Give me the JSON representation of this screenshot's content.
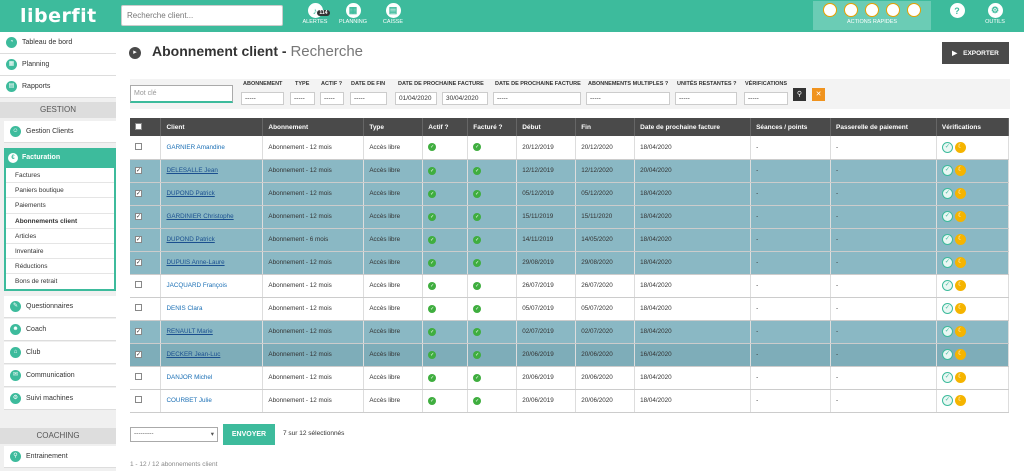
{
  "app": {
    "logo": "liberfit"
  },
  "search": {
    "placeholder": "Recherche client..."
  },
  "topnav": {
    "alertes": {
      "label": "ALERTES",
      "badge": "114"
    },
    "planning": {
      "label": "PLANNING"
    },
    "caisse": {
      "label": "CAISSE"
    },
    "actions_rapides": {
      "label": "ACTIONS RAPIDES"
    },
    "aide": {
      "label": "?"
    },
    "outils": {
      "label": "OUTILS"
    }
  },
  "sidebar": {
    "top_items": [
      {
        "label": "Tableau de bord",
        "icon": "dashboard-icon"
      },
      {
        "label": "Planning",
        "icon": "calendar-icon"
      },
      {
        "label": "Rapports",
        "icon": "report-icon"
      }
    ],
    "section_gestion": "GESTION",
    "gestion_clients": "Gestion Clients",
    "facturation": "Facturation",
    "facturation_sub": [
      "Factures",
      "Paniers boutique",
      "Paiements",
      "Abonnements client",
      "Articles",
      "Inventaire",
      "Réductions",
      "Bons de retrait"
    ],
    "after_items": [
      "Questionnaires",
      "Coach",
      "Club",
      "Communication",
      "Suivi machines"
    ],
    "section_coaching": "COACHING",
    "coaching_items": [
      "Entrainement"
    ]
  },
  "page": {
    "title": "Abonnement client",
    "subtitle": "Recherche",
    "export_label": "EXPORTER"
  },
  "filters": {
    "keyword_placeholder": "Mot clé",
    "cols": {
      "abonnement": "ABONNEMENT",
      "type": "TYPE",
      "actif": "ACTIF ?",
      "date_fin": "DATE DE FIN",
      "date_prochaine_1": "DATE DE PROCHAINE FACTURE",
      "date_prochaine_2": "DATE DE PROCHAINE FACTURE",
      "multiples": "ABONNEMENTS MULTIPLES ?",
      "unites": "UNITÉS RESTANTES ?",
      "verifications": "VÉRIFICATIONS"
    },
    "placeholder_dash": "-----",
    "date_from": "01/04/2020",
    "date_to": "30/04/2020"
  },
  "table": {
    "headers": [
      "Client",
      "Abonnement",
      "Type",
      "Actif ?",
      "Facturé ?",
      "Début",
      "Fin",
      "Date de prochaine facture",
      "Séances / points",
      "Passerelle de paiement",
      "Vérifications"
    ],
    "rows": [
      {
        "client": "GARNIER Amandine",
        "abonnement": "Abonnement - 12 mois",
        "type": "Accès libre",
        "debut": "20/12/2019",
        "fin": "20/12/2020",
        "prochaine": "18/04/2020",
        "seances": "-",
        "passerelle": "-",
        "selected": false
      },
      {
        "client": "DELESALLE Jean",
        "abonnement": "Abonnement - 12 mois",
        "type": "Accès libre",
        "debut": "12/12/2019",
        "fin": "12/12/2020",
        "prochaine": "20/04/2020",
        "seances": "-",
        "passerelle": "-",
        "selected": true
      },
      {
        "client": "DUPOND Patrick",
        "abonnement": "Abonnement - 12 mois",
        "type": "Accès libre",
        "debut": "05/12/2019",
        "fin": "05/12/2020",
        "prochaine": "18/04/2020",
        "seances": "-",
        "passerelle": "-",
        "selected": true
      },
      {
        "client": "GARDINIER Christophe",
        "abonnement": "Abonnement - 12 mois",
        "type": "Accès libre",
        "debut": "15/11/2019",
        "fin": "15/11/2020",
        "prochaine": "18/04/2020",
        "seances": "-",
        "passerelle": "-",
        "selected": true
      },
      {
        "client": "DUPOND Patrick",
        "abonnement": "Abonnement - 6 mois",
        "type": "Accès libre",
        "debut": "14/11/2019",
        "fin": "14/05/2020",
        "prochaine": "18/04/2020",
        "seances": "-",
        "passerelle": "-",
        "selected": true
      },
      {
        "client": "DUPUIS Anne-Laure",
        "abonnement": "Abonnement - 12 mois",
        "type": "Accès libre",
        "debut": "29/08/2019",
        "fin": "29/08/2020",
        "prochaine": "18/04/2020",
        "seances": "-",
        "passerelle": "-",
        "selected": true
      },
      {
        "client": "JACQUARD François",
        "abonnement": "Abonnement - 12 mois",
        "type": "Accès libre",
        "debut": "26/07/2019",
        "fin": "26/07/2020",
        "prochaine": "18/04/2020",
        "seances": "-",
        "passerelle": "-",
        "selected": false
      },
      {
        "client": "DENIS Clara",
        "abonnement": "Abonnement - 12 mois",
        "type": "Accès libre",
        "debut": "05/07/2019",
        "fin": "05/07/2020",
        "prochaine": "18/04/2020",
        "seances": "-",
        "passerelle": "-",
        "selected": false
      },
      {
        "client": "RENAULT Marie",
        "abonnement": "Abonnement - 12 mois",
        "type": "Accès libre",
        "debut": "02/07/2019",
        "fin": "02/07/2020",
        "prochaine": "18/04/2020",
        "seances": "-",
        "passerelle": "-",
        "selected": true
      },
      {
        "client": "DECKER Jean-Luc",
        "abonnement": "Abonnement - 12 mois",
        "type": "Accès libre",
        "debut": "20/06/2019",
        "fin": "20/06/2020",
        "prochaine": "16/04/2020",
        "seances": "-",
        "passerelle": "-",
        "selected": true
      },
      {
        "client": "DANJOR Michel",
        "abonnement": "Abonnement - 12 mois",
        "type": "Accès libre",
        "debut": "20/06/2019",
        "fin": "20/06/2020",
        "prochaine": "18/04/2020",
        "seances": "-",
        "passerelle": "-",
        "selected": false
      },
      {
        "client": "COURBET Julie",
        "abonnement": "Abonnement - 12 mois",
        "type": "Accès libre",
        "debut": "20/06/2019",
        "fin": "20/06/2020",
        "prochaine": "18/04/2020",
        "seances": "-",
        "passerelle": "-",
        "selected": false
      }
    ]
  },
  "footer": {
    "bulk_select": "---------",
    "send_label": "ENVOYER",
    "selection_text": "7 sur 12 sélectionnés",
    "pager_text": "1 - 12  /  12 abonnements client"
  },
  "colors": {
    "accent": "#3dbb9c",
    "dark": "#4a4a4a",
    "selected_row": "#8ab8c4",
    "check_green": "#3fae3f",
    "warn": "#f5b400"
  }
}
